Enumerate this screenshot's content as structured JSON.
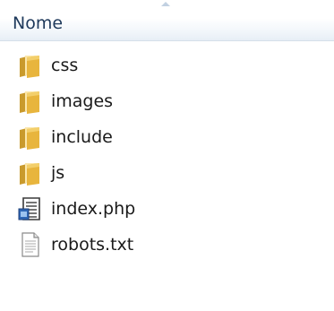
{
  "column_header": {
    "label": "Nome",
    "sort_direction": "ascending"
  },
  "files": [
    {
      "name": "css",
      "icon": "folder-icon"
    },
    {
      "name": "images",
      "icon": "folder-icon"
    },
    {
      "name": "include",
      "icon": "folder-icon"
    },
    {
      "name": "js",
      "icon": "folder-icon"
    },
    {
      "name": "index.php",
      "icon": "php-file-icon"
    },
    {
      "name": "robots.txt",
      "icon": "text-file-icon"
    }
  ],
  "colors": {
    "header_text": "#1e395b",
    "folder": "#e8b53d",
    "text": "#1a1a1a"
  }
}
